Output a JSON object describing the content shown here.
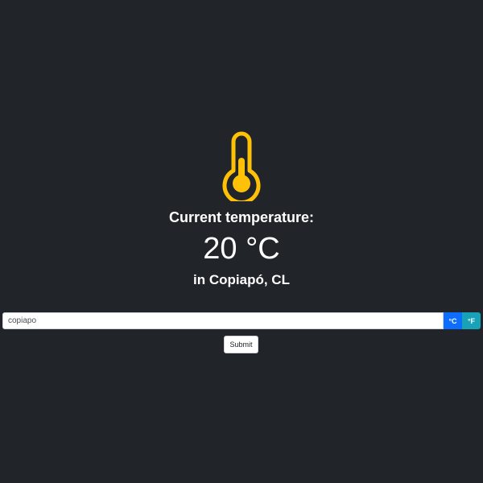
{
  "weather": {
    "heading": "Current temperature:",
    "temperature": "20 °C",
    "location": "in Copiapó, CL",
    "icon": "thermometer-icon",
    "icon_color": "#ffc107"
  },
  "search": {
    "value": "copiapo",
    "unit_celsius": "°C",
    "unit_fahrenheit": "°F",
    "celsius_color": "#0d6efd",
    "fahrenheit_color": "#17a2b8",
    "submit_label": "Submit"
  },
  "colors": {
    "background": "#212529",
    "text": "#ffffff"
  }
}
